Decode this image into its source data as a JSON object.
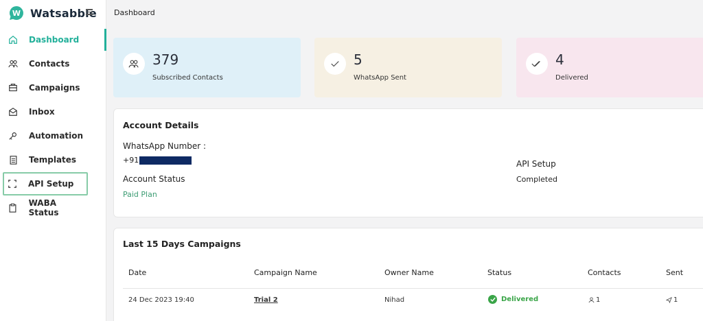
{
  "brand": {
    "name": "Watsabble"
  },
  "header": {
    "title": "Dashboard"
  },
  "sidebar": {
    "items": [
      {
        "label": "Dashboard",
        "icon": "home-icon"
      },
      {
        "label": "Contacts",
        "icon": "users-icon"
      },
      {
        "label": "Campaigns",
        "icon": "campaign-icon"
      },
      {
        "label": "Inbox",
        "icon": "inbox-icon"
      },
      {
        "label": "Automation",
        "icon": "automation-icon"
      },
      {
        "label": "Templates",
        "icon": "template-icon"
      },
      {
        "label": "API Setup",
        "icon": "api-icon"
      },
      {
        "label": "WABA Status",
        "icon": "clipboard-icon"
      }
    ]
  },
  "stats": [
    {
      "value": "379",
      "label": "Subscribed Contacts",
      "bg": "#dff0f8"
    },
    {
      "value": "5",
      "label": "WhatsApp Sent",
      "bg": "#f6f0e3"
    },
    {
      "value": "4",
      "label": "Delivered",
      "bg": "#f8e6ee"
    }
  ],
  "account": {
    "title": "Account Details",
    "whatsapp_label": "WhatsApp Number :",
    "whatsapp_prefix": "+91",
    "status_label": "Account Status",
    "status_value": "Paid Plan",
    "api_label": "API Setup",
    "api_value": "Completed"
  },
  "campaigns": {
    "title": "Last 15 Days Campaigns",
    "headers": [
      "Date",
      "Campaign Name",
      "Owner Name",
      "Status",
      "Contacts",
      "Sent"
    ],
    "rows": [
      {
        "date": "24 Dec 2023 19:40",
        "name": "Trial 2",
        "owner": "Nihad",
        "status": "Delivered",
        "contacts": "1",
        "sent": "1"
      }
    ]
  },
  "colors": {
    "accent": "#22b09a",
    "delivered": "#3aa548"
  }
}
